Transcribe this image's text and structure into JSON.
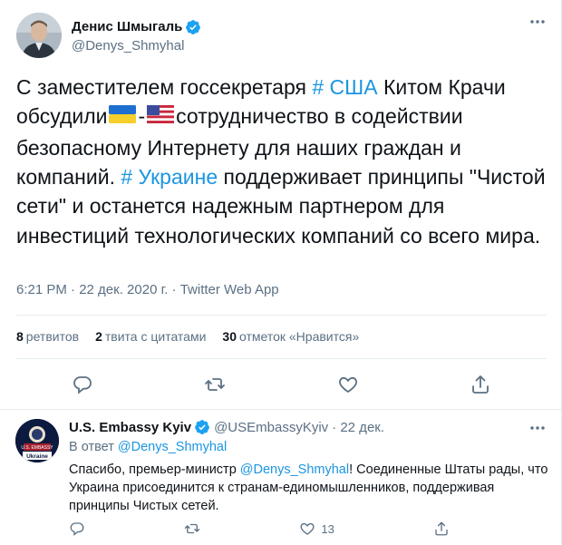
{
  "tweet": {
    "author_name": "Денис Шмыгаль",
    "author_handle": "@Denys_Shmyhal",
    "text": {
      "p1": "С заместителем госсекретаря ",
      "tag1": "# США",
      "p2": " Китом Крачи обсудили",
      "dash": "-",
      "p3": "сотрудничество в содействии безопасному Интернету для наших граждан и компаний. ",
      "tag2": "# Украине",
      "p4": " поддерживает принципы \"Чистой сети\" и останется надежным партнером для инвестиций технологических компаний со всего мира."
    },
    "meta": "6:21 PM · 22 дек. 2020 г. · Twitter Web App",
    "stats": {
      "retweets_count": "8",
      "retweets_label": "ретвитов",
      "quotes_count": "2",
      "quotes_label": "твита с цитатами",
      "likes_count": "30",
      "likes_label": "отметок «Нравится»"
    },
    "colors": {
      "link": "#1b95e0",
      "verified": "#1da1f2",
      "secondary": "#5b7083"
    }
  },
  "reply": {
    "author_name": "U.S. Embassy Kyiv",
    "author_handle": "@USEmbassyKyiv",
    "date": "· 22 дек.",
    "avatar_caption": "Ukraine",
    "in_reply_prefix": "В ответ ",
    "in_reply_handle": "@Denys_Shmyhal",
    "text": {
      "p1": "Спасибо, премьер-министр ",
      "mention": "@Denys_Shmyhal",
      "p2": "! Соединенные Штаты рады, что Украина присоединится к странам-единомышленников, поддерживая принципы Чистых сетей."
    },
    "likes_count": "13"
  },
  "icons": [
    "verified-badge-icon",
    "more-icon",
    "reply-icon",
    "retweet-icon",
    "like-icon",
    "share-icon",
    "ukraine-flag-icon",
    "usa-flag-icon"
  ]
}
